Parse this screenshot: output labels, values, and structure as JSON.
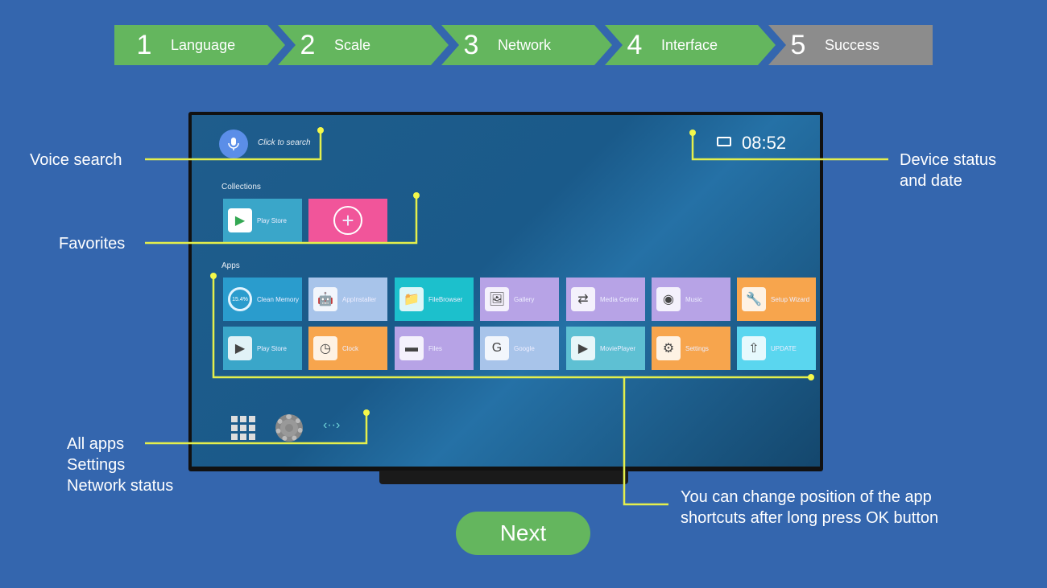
{
  "steps": [
    {
      "num": "1",
      "label": "Language"
    },
    {
      "num": "2",
      "label": "Scale"
    },
    {
      "num": "3",
      "label": "Network"
    },
    {
      "num": "4",
      "label": "Interface"
    },
    {
      "num": "5",
      "label": "Success"
    }
  ],
  "tv": {
    "search_placeholder": "Click to search",
    "time": "08:52",
    "collections_label": "Collections",
    "collections": [
      {
        "label": "Play Store",
        "color": "#3aa6c9"
      }
    ],
    "apps_label": "Apps",
    "apps": [
      {
        "label": "15.4%",
        "sub": "Clean Memory",
        "color": "#2a9ccd"
      },
      {
        "label": "AppInstaller",
        "color": "#a8c4ea"
      },
      {
        "label": "FileBrowser",
        "color": "#1cc0cc"
      },
      {
        "label": "Gallery",
        "color": "#b7a3e6"
      },
      {
        "label": "Media Center",
        "color": "#b7a3e6"
      },
      {
        "label": "Music",
        "color": "#b7a3e6"
      },
      {
        "label": "Setup Wizard",
        "color": "#f7a54d"
      },
      {
        "label": "Play Store",
        "color": "#3aa6c9"
      },
      {
        "label": "Clock",
        "color": "#f7a54d"
      },
      {
        "label": "Files",
        "color": "#b7a3e6"
      },
      {
        "label": "Google",
        "color": "#a8c4ea"
      },
      {
        "label": "MoviePlayer",
        "color": "#5ec0d3"
      },
      {
        "label": "Settings",
        "color": "#f7a54d"
      },
      {
        "label": "UPDATE",
        "color": "#5ad6ef"
      }
    ]
  },
  "annotations": {
    "voice_search": "Voice search",
    "favorites": "Favorites",
    "device_status": "Device status and date",
    "bottom_bar": [
      "All apps",
      "Settings",
      "Network status"
    ],
    "reorder": "You can change position of the app shortcuts after long press OK button"
  },
  "next_label": "Next",
  "colors": {
    "background": "#3466ae",
    "step_done": "#64b65e",
    "step_pending": "#8c8c8c",
    "annotation_line": "#e4ef4c"
  }
}
